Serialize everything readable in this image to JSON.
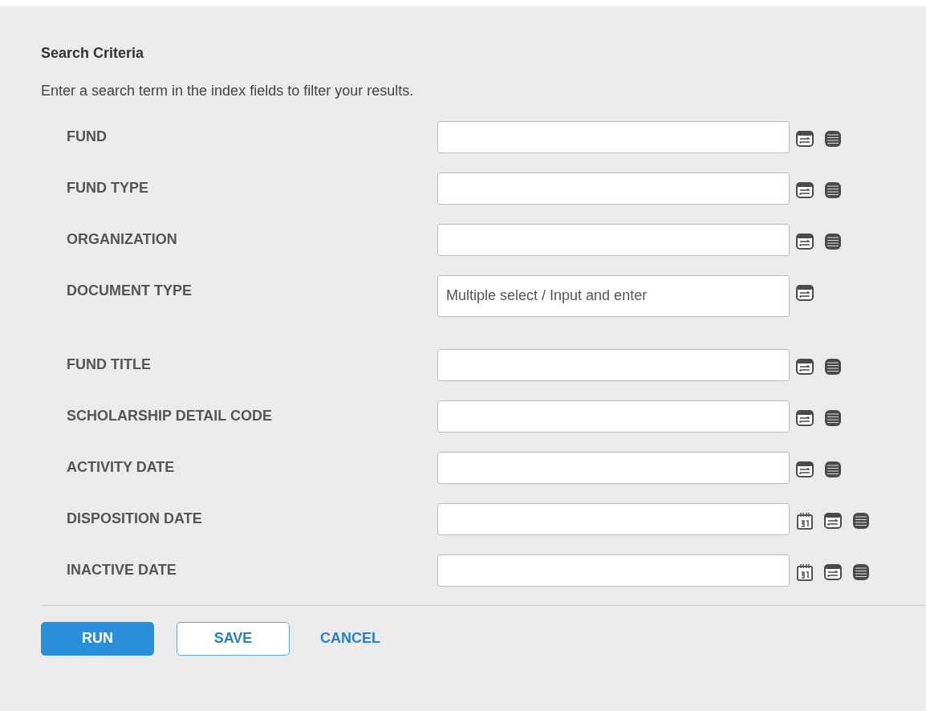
{
  "panel": {
    "title": "Search Criteria",
    "instructions": "Enter a search term in the index fields to filter your results."
  },
  "fields": [
    {
      "label": "FUND",
      "kind": "text",
      "calendar": false,
      "list": true
    },
    {
      "label": "FUND TYPE",
      "kind": "text",
      "calendar": false,
      "list": true
    },
    {
      "label": "ORGANIZATION",
      "kind": "text",
      "calendar": false,
      "list": true
    },
    {
      "label": "DOCUMENT TYPE",
      "kind": "multi",
      "placeholder": "Multiple select / Input and enter",
      "calendar": false,
      "list": false
    },
    {
      "label": "FUND TITLE",
      "kind": "text",
      "calendar": false,
      "list": true
    },
    {
      "label": "SCHOLARSHIP DETAIL CODE",
      "kind": "text",
      "calendar": false,
      "list": true
    },
    {
      "label": "ACTIVITY DATE",
      "kind": "text",
      "calendar": false,
      "list": true
    },
    {
      "label": "DISPOSITION DATE",
      "kind": "text",
      "calendar": true,
      "list": true
    },
    {
      "label": "INACTIVE DATE",
      "kind": "text",
      "calendar": true,
      "list": true
    }
  ],
  "buttons": [
    {
      "label": "RUN",
      "kind": "primary"
    },
    {
      "label": "SAVE",
      "kind": "outline"
    },
    {
      "label": "CANCEL",
      "kind": "link"
    }
  ]
}
